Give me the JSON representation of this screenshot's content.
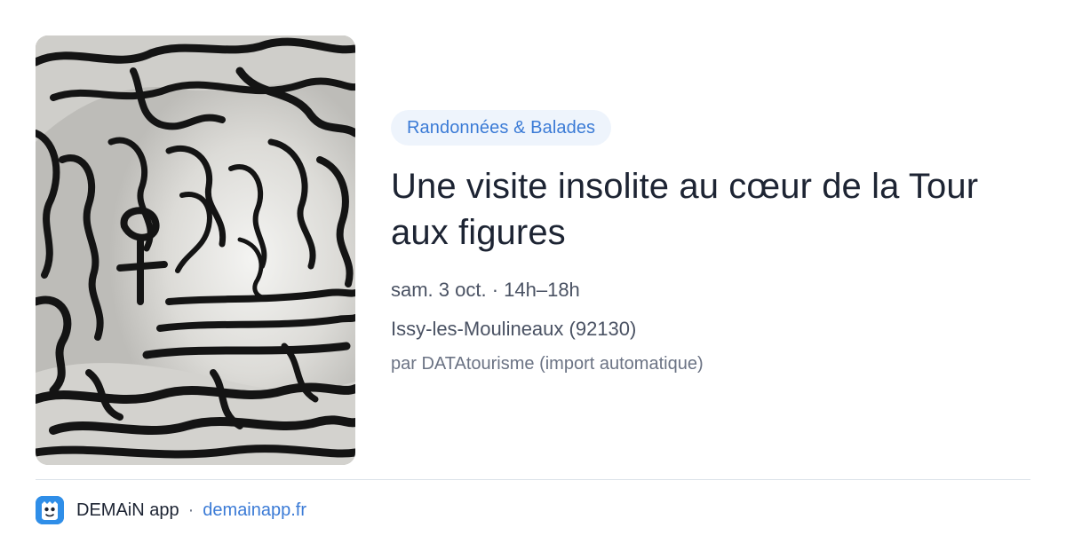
{
  "event": {
    "category": "Randonnées & Balades",
    "title": "Une visite insolite au cœur de la Tour aux figures",
    "date_time": "sam. 3 oct. · 14h–18h",
    "location": "Issy-les-Moulineaux (92130)",
    "source": "par DATAtourisme (import automatique)",
    "image_icon": "sculpture-photo"
  },
  "footer": {
    "app_name": "DEMAiN app",
    "separator": "·",
    "url": "demainapp.fr",
    "logo_icon": "demain-app-logo-icon"
  },
  "colors": {
    "accent": "#3b7bd6",
    "pill_bg": "#eef4fc",
    "text": "#1d2433",
    "muted": "#4a5263",
    "logo_bg": "#2f8ee8"
  }
}
